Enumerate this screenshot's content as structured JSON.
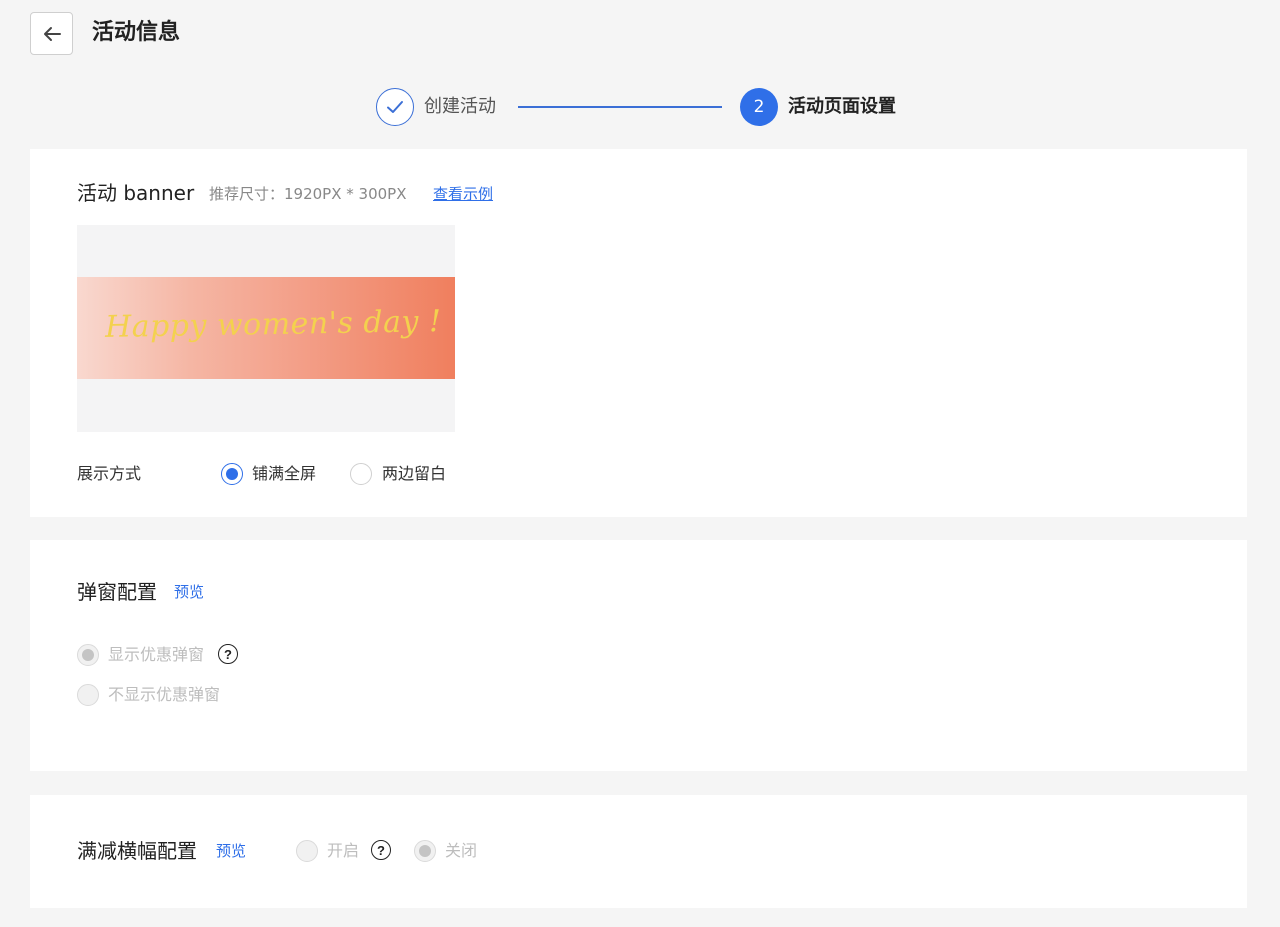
{
  "header": {
    "title": "活动信息"
  },
  "steps": [
    {
      "label": "创建活动",
      "status": "done"
    },
    {
      "number": "2",
      "label": "活动页面设置",
      "status": "active"
    }
  ],
  "banner_section": {
    "title": "活动 banner",
    "hint": "推荐尺寸：1920PX * 300PX",
    "example_link": "查看示例",
    "banner_text": "Happy women's day !",
    "display_label": "展示方式",
    "options": [
      {
        "label": "铺满全屏",
        "selected": true
      },
      {
        "label": "两边留白",
        "selected": false
      }
    ]
  },
  "popup_section": {
    "title": "弹窗配置",
    "preview_link": "预览",
    "options": [
      {
        "label": "显示优惠弹窗",
        "selected": true,
        "disabled": true
      },
      {
        "label": "不显示优惠弹窗",
        "selected": false,
        "disabled": true
      }
    ]
  },
  "fullcut_section": {
    "title": "满减横幅配置",
    "preview_link": "预览",
    "options": [
      {
        "label": "开启",
        "selected": false,
        "disabled": true
      },
      {
        "label": "关闭",
        "selected": true,
        "disabled": true
      }
    ]
  },
  "colors": {
    "accent": "#2f6fe8",
    "background": "#f5f5f5"
  }
}
